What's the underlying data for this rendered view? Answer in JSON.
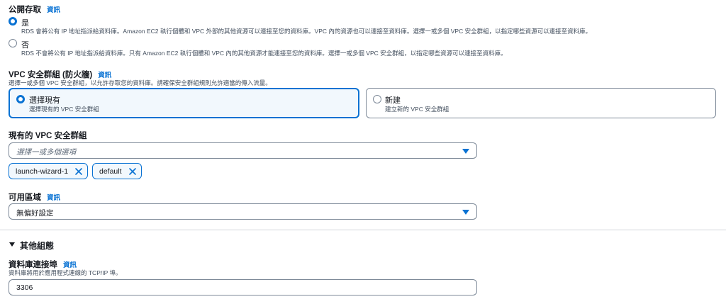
{
  "public_access": {
    "label": "公開存取",
    "info": "資訊",
    "options": [
      {
        "title": "是",
        "desc": "RDS 會將公有 IP 地址指派給資料庫。Amazon EC2 執行個體和 VPC 外部的其他資源可以連接至您的資料庫。VPC 內的資源也可以連接至資料庫。選擇一或多個 VPC 安全群組，以指定哪些資源可以連接至資料庫。",
        "selected": true
      },
      {
        "title": "否",
        "desc": "RDS 不會將公有 IP 地址指派給資料庫。只有 Amazon EC2 執行個體和 VPC 內的其他資源才能連接至您的資料庫。選擇一或多個 VPC 安全群組，以指定哪些資源可以連接至資料庫。",
        "selected": false
      }
    ]
  },
  "vpc_sg": {
    "label": "VPC 安全群組 (防火牆)",
    "info": "資訊",
    "desc": "選擇一或多個 VPC 安全群組，以允許存取您的資料庫。請確保安全群組規則允許適當的傳入流量。",
    "tiles": [
      {
        "title": "選擇現有",
        "desc": "選擇現有的 VPC 安全群組",
        "selected": true
      },
      {
        "title": "新建",
        "desc": "建立新的 VPC 安全群組",
        "selected": false
      }
    ]
  },
  "existing_sg": {
    "label": "現有的 VPC 安全群組",
    "placeholder": "選擇一或多個選項",
    "tokens": [
      "launch-wizard-1",
      "default"
    ]
  },
  "az": {
    "label": "可用區域",
    "info": "資訊",
    "value": "無偏好設定"
  },
  "additional": {
    "title": "其他組態",
    "expanded": true
  },
  "db_port": {
    "label": "資料庫連接埠",
    "info": "資訊",
    "desc": "資料庫將用於應用程式連線的 TCP/IP 埠。",
    "value": "3306"
  },
  "colors": {
    "accent": "#0972d3",
    "text": "#16191f",
    "muted": "#414d5c",
    "border": "#7d8998"
  }
}
